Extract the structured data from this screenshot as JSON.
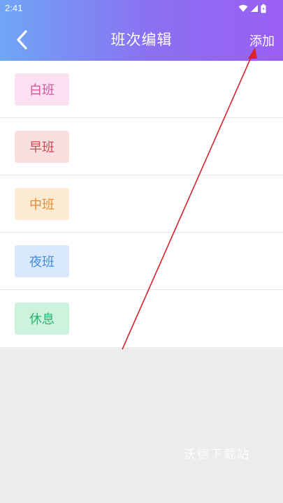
{
  "status_bar": {
    "time": "2:41",
    "icons": [
      "wifi-icon",
      "signal-icon",
      "battery-icon"
    ]
  },
  "header": {
    "title": "班次编辑",
    "add_label": "添加",
    "back_icon": "chevron-left-icon",
    "gradient": [
      "#6fa6f5",
      "#9b5ff3"
    ]
  },
  "shifts": [
    {
      "label": "白班",
      "bg": "#fbe0f1",
      "fg": "#d9559b"
    },
    {
      "label": "早班",
      "bg": "#fadfe0",
      "fg": "#d8464f"
    },
    {
      "label": "中班",
      "bg": "#fdebd3",
      "fg": "#ef8a2c"
    },
    {
      "label": "夜班",
      "bg": "#d9e8fb",
      "fg": "#3d8de0"
    },
    {
      "label": "休息",
      "bg": "#cdf3df",
      "fg": "#27b66a"
    }
  ],
  "watermark": "沃德下载站",
  "annotation_color": "#d8232a"
}
